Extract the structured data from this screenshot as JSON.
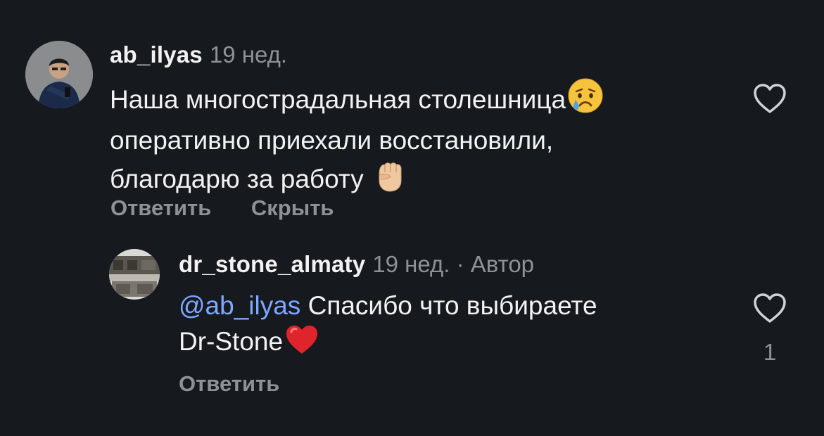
{
  "comments": [
    {
      "username": "ab_ilyas",
      "time": "19 нед.",
      "lines": [
        "Наша многострадальная столешница",
        "оперативно приехали восстановили,",
        "благодарю за работу"
      ],
      "emojis": [
        "crying-face",
        "raised-fist-light-skin"
      ],
      "actions": {
        "reply": "Ответить",
        "hide": "Скрыть"
      },
      "like_count": ""
    },
    {
      "username": "dr_stone_almaty",
      "time": "19 нед.",
      "author_badge": "· Автор",
      "mention": "@ab_ilyas",
      "lines": [
        "Спасибо что выбираете",
        "Dr-Stone"
      ],
      "emojis": [
        "red-heart"
      ],
      "actions": {
        "reply": "Ответить"
      },
      "like_count": "1"
    }
  ],
  "colors": {
    "background": "#16191d",
    "text": "#f2f2f2",
    "secondary": "#8e9297",
    "mention": "#7ea7ff",
    "heart": "#e0242b"
  }
}
